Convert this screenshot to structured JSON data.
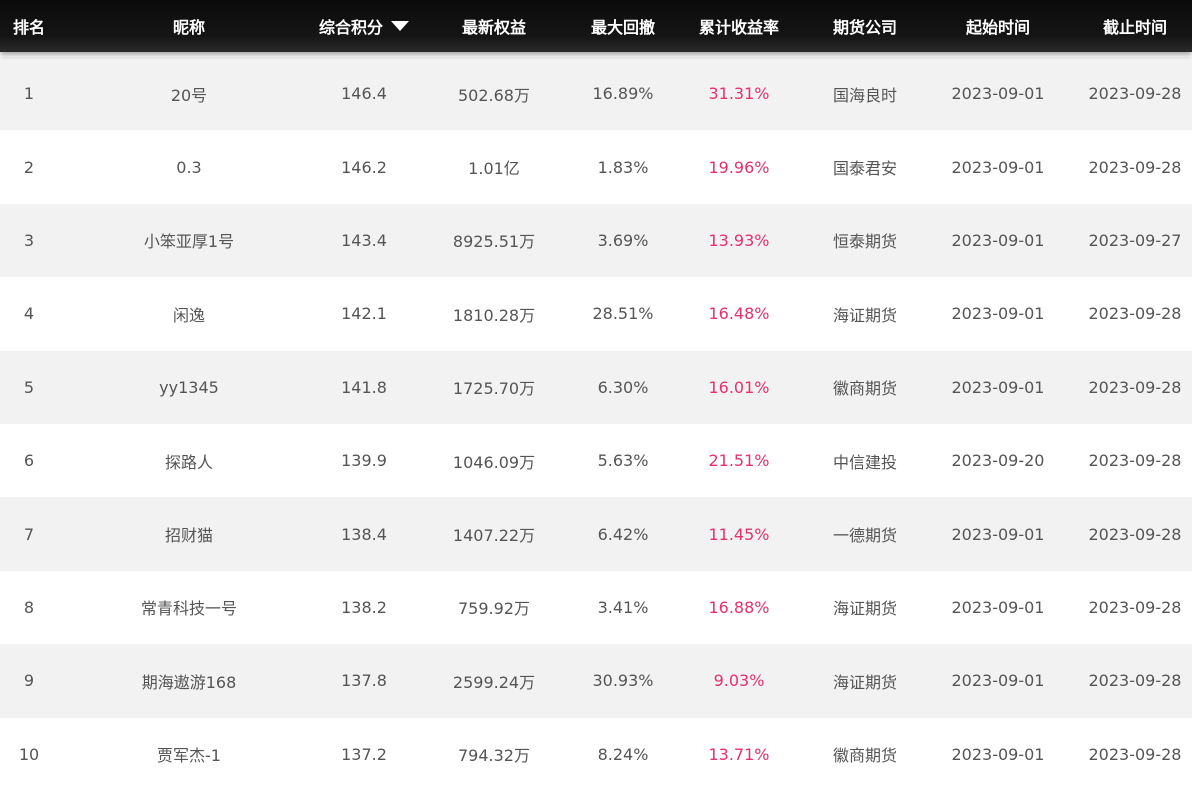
{
  "header": {
    "rank": "排名",
    "nickname": "昵称",
    "score": "综合积分",
    "equity": "最新权益",
    "drawdown": "最大回撤",
    "return_rate": "累计收益率",
    "company": "期货公司",
    "start_date": "起始时间",
    "end_date": "截止时间",
    "sort_icon": "caret-down-icon"
  },
  "colors": {
    "header_bg": "#111111",
    "header_text": "#ffffff",
    "row_alt_bg": "#f2f2f2",
    "text": "#555555",
    "accent_pink": "#e8306b"
  },
  "rows": [
    {
      "rank": "1",
      "nickname": "20号",
      "score": "146.4",
      "equity": "502.68万",
      "drawdown": "16.89%",
      "return_rate": "31.31%",
      "company": "国海良时",
      "start_date": "2023-09-01",
      "end_date": "2023-09-28"
    },
    {
      "rank": "2",
      "nickname": "0.3",
      "score": "146.2",
      "equity": "1.01亿",
      "drawdown": "1.83%",
      "return_rate": "19.96%",
      "company": "国泰君安",
      "start_date": "2023-09-01",
      "end_date": "2023-09-28"
    },
    {
      "rank": "3",
      "nickname": "小笨亚厚1号",
      "score": "143.4",
      "equity": "8925.51万",
      "drawdown": "3.69%",
      "return_rate": "13.93%",
      "company": "恒泰期货",
      "start_date": "2023-09-01",
      "end_date": "2023-09-27"
    },
    {
      "rank": "4",
      "nickname": "闲逸",
      "score": "142.1",
      "equity": "1810.28万",
      "drawdown": "28.51%",
      "return_rate": "16.48%",
      "company": "海证期货",
      "start_date": "2023-09-01",
      "end_date": "2023-09-28"
    },
    {
      "rank": "5",
      "nickname": "yy1345",
      "score": "141.8",
      "equity": "1725.70万",
      "drawdown": "6.30%",
      "return_rate": "16.01%",
      "company": "徽商期货",
      "start_date": "2023-09-01",
      "end_date": "2023-09-28"
    },
    {
      "rank": "6",
      "nickname": "探路人",
      "score": "139.9",
      "equity": "1046.09万",
      "drawdown": "5.63%",
      "return_rate": "21.51%",
      "company": "中信建投",
      "start_date": "2023-09-20",
      "end_date": "2023-09-28"
    },
    {
      "rank": "7",
      "nickname": "招财猫",
      "score": "138.4",
      "equity": "1407.22万",
      "drawdown": "6.42%",
      "return_rate": "11.45%",
      "company": "一德期货",
      "start_date": "2023-09-01",
      "end_date": "2023-09-28"
    },
    {
      "rank": "8",
      "nickname": "常青科技一号",
      "score": "138.2",
      "equity": "759.92万",
      "drawdown": "3.41%",
      "return_rate": "16.88%",
      "company": "海证期货",
      "start_date": "2023-09-01",
      "end_date": "2023-09-28"
    },
    {
      "rank": "9",
      "nickname": "期海遨游168",
      "score": "137.8",
      "equity": "2599.24万",
      "drawdown": "30.93%",
      "return_rate": "9.03%",
      "company": "海证期货",
      "start_date": "2023-09-01",
      "end_date": "2023-09-28"
    },
    {
      "rank": "10",
      "nickname": "贾军杰-1",
      "score": "137.2",
      "equity": "794.32万",
      "drawdown": "8.24%",
      "return_rate": "13.71%",
      "company": "徽商期货",
      "start_date": "2023-09-01",
      "end_date": "2023-09-28"
    }
  ]
}
